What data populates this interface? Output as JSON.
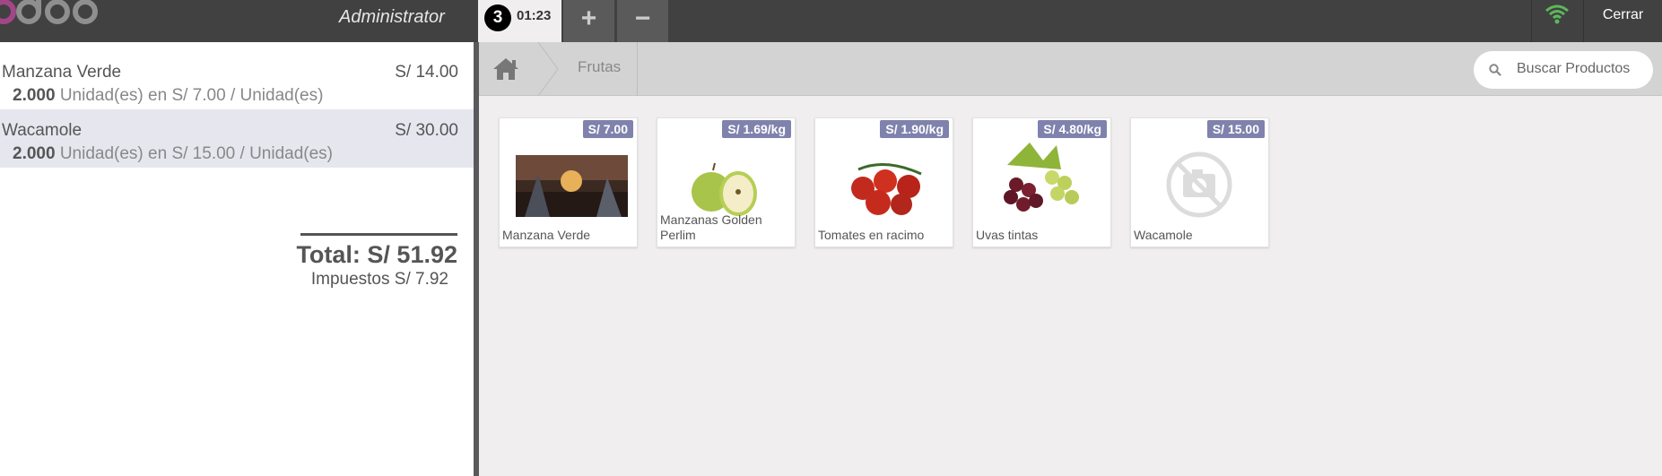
{
  "topbar": {
    "user": "Administrator",
    "order_number": "3",
    "order_time": "01:23",
    "add_label": "+",
    "remove_label": "−",
    "close_label": "Cerrar",
    "wifi_color": "#5cb85c"
  },
  "orderlines": [
    {
      "name": "Manzana Verde",
      "price": "S/ 14.00",
      "qty": "2.000",
      "detail": "Unidad(es) en S/ 7.00 / Unidad(es)",
      "selected": false
    },
    {
      "name": "Wacamole",
      "price": "S/ 30.00",
      "qty": "2.000",
      "detail": "Unidad(es) en S/ 15.00 / Unidad(es)",
      "selected": true
    }
  ],
  "summary": {
    "total": "Total: S/ 51.92",
    "taxes": "Impuestos S/ 7.92"
  },
  "breadcrumb": {
    "home_icon": "home-icon",
    "category": "Frutas"
  },
  "search": {
    "placeholder": "Buscar Productos"
  },
  "products": [
    {
      "name": "Manzana Verde",
      "price": "S/ 7.00",
      "image": "sci-fi scene picture"
    },
    {
      "name": "Manzanas Golden Perlim",
      "price": "S/ 1.69/kg",
      "image": "green apples"
    },
    {
      "name": "Tomates en racimo",
      "price": "S/ 1.90/kg",
      "image": "tomatoes on vine"
    },
    {
      "name": "Uvas tintas",
      "price": "S/ 4.80/kg",
      "image": "red and green grapes"
    },
    {
      "name": "Wacamole",
      "price": "S/ 15.00",
      "image": "no-image-camera-icon"
    }
  ],
  "colors": {
    "price_tag": "#7f82ac",
    "selected_line": "#e6e6ef",
    "logo_purple": "#a24689"
  }
}
